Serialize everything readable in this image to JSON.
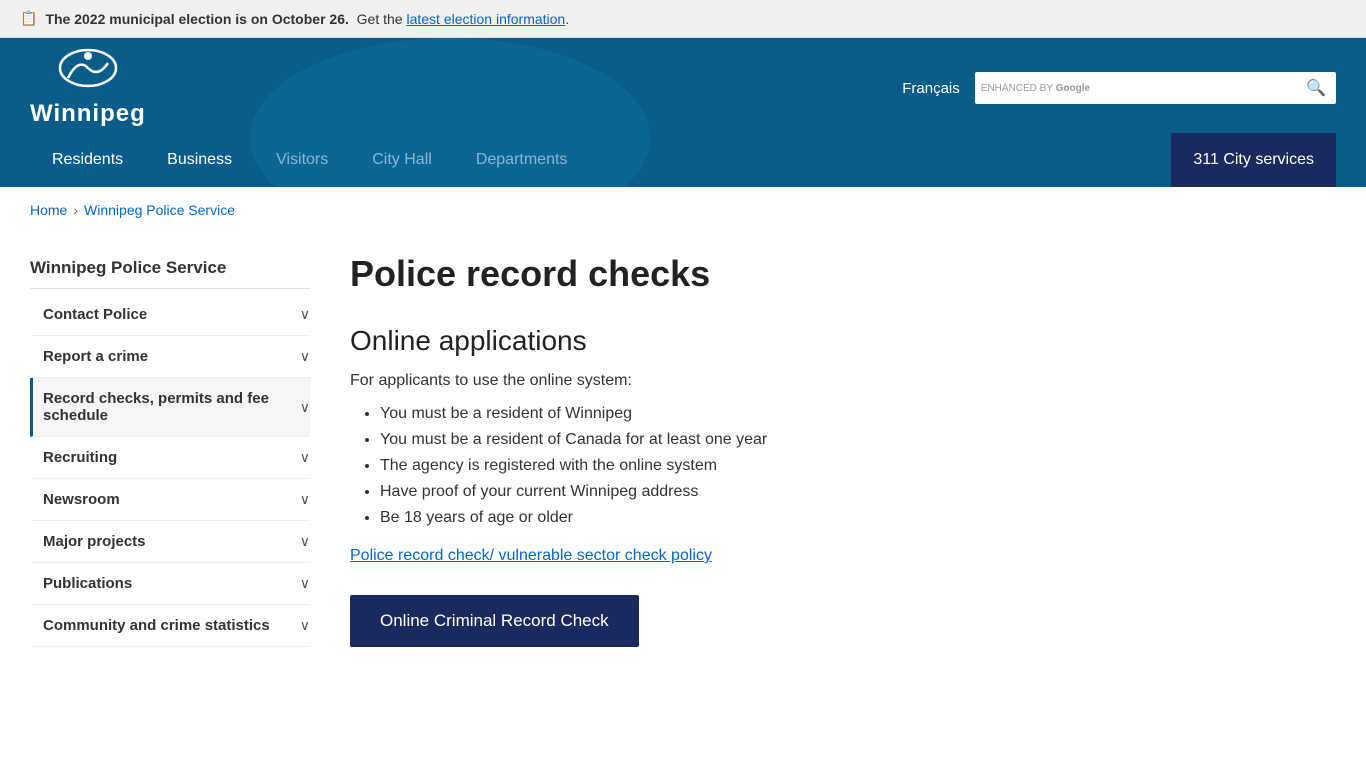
{
  "announcement": {
    "prefix": "The 2022 municipal election is on October 26.",
    "middle": "Get the",
    "link_text": "latest election information",
    "suffix": ".",
    "icon": "📋"
  },
  "header": {
    "logo_text": "Winnipeg",
    "francais_label": "Français",
    "search_placeholder": "enhanced by Google",
    "search_label": "ENHANCED BY",
    "search_google": "Google"
  },
  "nav": {
    "items": [
      {
        "label": "Residents"
      },
      {
        "label": "Business"
      },
      {
        "label": "Visitors"
      },
      {
        "label": "City Hall"
      },
      {
        "label": "Departments"
      }
    ],
    "cta_label": "311 City services"
  },
  "breadcrumb": {
    "home": "Home",
    "current": "Winnipeg Police Service"
  },
  "sidebar": {
    "title": "Winnipeg Police Service",
    "items": [
      {
        "label": "Contact Police"
      },
      {
        "label": "Report a crime"
      },
      {
        "label": "Record checks, permits and fee schedule",
        "active": true
      },
      {
        "label": "Recruiting"
      },
      {
        "label": "Newsroom"
      },
      {
        "label": "Major projects"
      },
      {
        "label": "Publications"
      },
      {
        "label": "Community and crime statistics"
      }
    ]
  },
  "content": {
    "page_title": "Police record checks",
    "online_section_title": "Online applications",
    "intro_text": "For applicants to use the online system:",
    "requirements": [
      "You must be a resident of Winnipeg",
      "You must be a resident of Canada for at least one year",
      "The agency is registered with the online system",
      "Have proof of your current Winnipeg address",
      "Be 18 years of age or older"
    ],
    "policy_link_text": "Police record check/ vulnerable sector check policy",
    "cta_button_label": "Online Criminal Record Check"
  }
}
